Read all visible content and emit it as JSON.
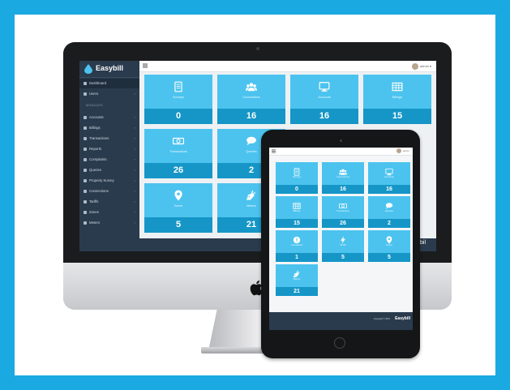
{
  "app": {
    "name": "Easybill"
  },
  "topbar": {
    "user": "admin"
  },
  "sidebar": {
    "section_label": "MODULES",
    "items": [
      {
        "label": "Dashboard",
        "icon": "home-icon",
        "active": true
      },
      {
        "label": "Users",
        "icon": "user-icon"
      },
      {
        "label": "Accounts",
        "icon": "monitor-icon"
      },
      {
        "label": "Billings",
        "icon": "table-icon"
      },
      {
        "label": "Transactions",
        "icon": "cash-icon"
      },
      {
        "label": "Reports",
        "icon": "bar-chart-icon"
      },
      {
        "label": "Complaints",
        "icon": "alert-icon"
      },
      {
        "label": "Queries",
        "icon": "chat-icon"
      },
      {
        "label": "Property Survey",
        "icon": "tablet-icon"
      },
      {
        "label": "Connections",
        "icon": "users-icon"
      },
      {
        "label": "Tariffs",
        "icon": "bolt-icon"
      },
      {
        "label": "Zones",
        "icon": "map-pin-icon"
      },
      {
        "label": "Meters",
        "icon": "plug-icon"
      }
    ]
  },
  "desktop_tiles": [
    {
      "label": "Surveys",
      "value": "0",
      "icon": "tablet-icon"
    },
    {
      "label": "Connections",
      "value": "16",
      "icon": "users-icon"
    },
    {
      "label": "Accounts",
      "value": "16",
      "icon": "monitor-icon"
    },
    {
      "label": "Billings",
      "value": "15",
      "icon": "table-icon"
    },
    {
      "label": "Transactions",
      "value": "26",
      "icon": "cash-icon"
    },
    {
      "label": "Queries",
      "value": "2",
      "icon": "chat-icon"
    },
    {
      "label": "Zones",
      "value": "5",
      "icon": "map-pin-icon"
    },
    {
      "label": "Meters",
      "value": "21",
      "icon": "plug-icon"
    }
  ],
  "tablet_tiles": [
    {
      "label": "Surveys",
      "value": "0",
      "icon": "tablet-icon"
    },
    {
      "label": "Connections",
      "value": "16",
      "icon": "users-icon"
    },
    {
      "label": "Accounts",
      "value": "16",
      "icon": "monitor-icon"
    },
    {
      "label": "Billings",
      "value": "15",
      "icon": "table-icon"
    },
    {
      "label": "Transactions",
      "value": "26",
      "icon": "cash-icon"
    },
    {
      "label": "Queries",
      "value": "2",
      "icon": "chat-icon"
    },
    {
      "label": "Complaints",
      "value": "1",
      "icon": "alert-icon"
    },
    {
      "label": "Tariffs",
      "value": "5",
      "icon": "bolt-icon"
    },
    {
      "label": "Zones",
      "value": "5",
      "icon": "map-pin-icon"
    },
    {
      "label": "Meters",
      "value": "21",
      "icon": "plug-icon"
    }
  ],
  "tablet_footer": {
    "copyright": "Copyright © 2015",
    "brand": "Easybill"
  },
  "peek_text": "bil",
  "colors": {
    "background": "#1aa9e1",
    "tile": "#4cc3ee",
    "tile_value_bar": "#1596c7",
    "sidebar": "#2a3b4d"
  }
}
